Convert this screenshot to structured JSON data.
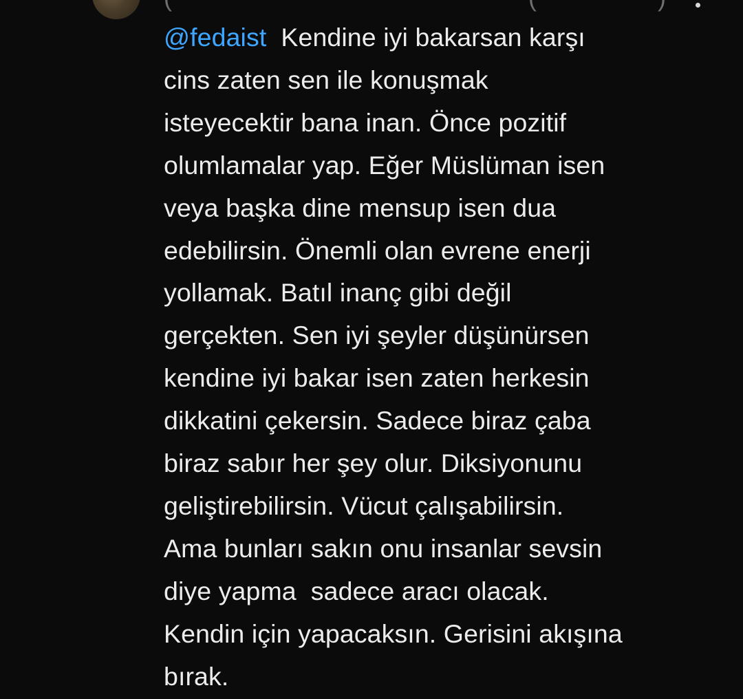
{
  "comment": {
    "mention": "@fedaist",
    "text": "  Kendine iyi bakarsan karşı\ncins zaten sen ile konuşmak\nisteyecektir bana inan. Önce pozitif\nolumlamalar yap. Eğer Müslüman isen\nveya başka dine mensup isen dua\nedebilirsin. Önemli olan evrene enerji\nyollamak. Batıl inanç gibi değil\ngerçekten. Sen iyi şeyler düşünürsen\nkendine iyi bakar isen zaten herkesin\ndikkatini çekersin. Sadece biraz çaba\nbiraz sabır her şey olur. Diksiyonunu\ngeliştirebilirsin. Vücut çalışabilirsin.\nAma bunları sakın onu insanlar sevsin\ndiye yapma  sadece aracı olacak.\nKendin için yapacaksın. Gerisini akışına\nbırak."
  },
  "icons": {
    "avatar": "avatar",
    "more": "more-vertical-icon"
  },
  "colors": {
    "background": "#0b0b0c",
    "text": "#ececec",
    "mention": "#3ea6ff"
  }
}
